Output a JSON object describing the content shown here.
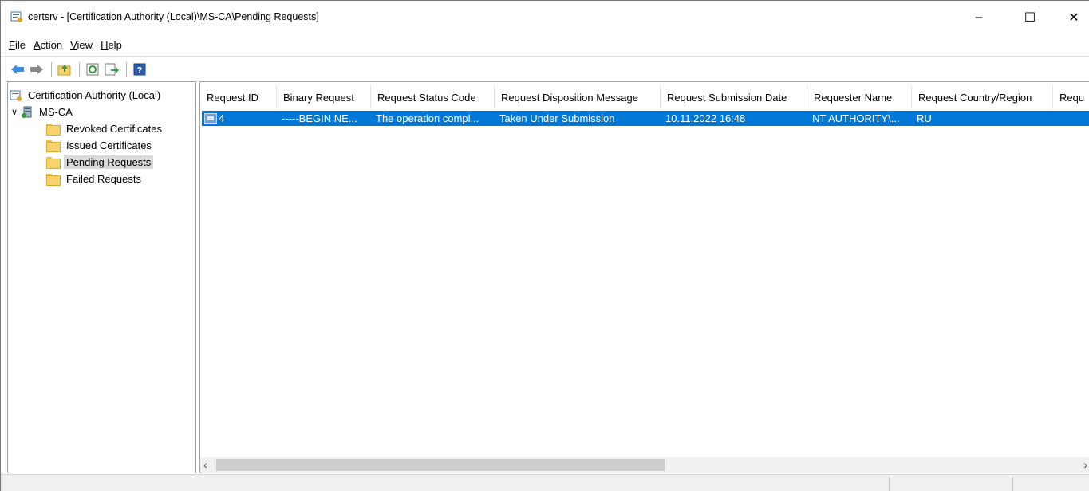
{
  "window": {
    "title": "certsrv - [Certification Authority (Local)\\MS-CA\\Pending Requests]",
    "controls": {
      "minimize": "–",
      "maximize": "☐",
      "close": "✕"
    }
  },
  "menu": {
    "items": [
      {
        "accel": "F",
        "rest": "ile"
      },
      {
        "accel": "A",
        "rest": "ction"
      },
      {
        "accel": "V",
        "rest": "iew"
      },
      {
        "accel": "H",
        "rest": "elp"
      }
    ]
  },
  "toolbar": {
    "buttons": [
      "back-arrow-icon",
      "forward-arrow-icon",
      "up-folder-icon",
      "refresh-icon",
      "export-list-icon",
      "help-icon"
    ]
  },
  "tree": {
    "root": "Certification Authority (Local)",
    "ca": "MS-CA",
    "folders": [
      "Revoked Certificates",
      "Issued Certificates",
      "Pending Requests",
      "Failed Requests"
    ],
    "selected": "Pending Requests"
  },
  "list": {
    "columns": [
      "Request ID",
      "Binary Request",
      "Request Status Code",
      "Request Disposition Message",
      "Request Submission Date",
      "Requester Name",
      "Request Country/Region",
      "Requ"
    ],
    "rows": [
      {
        "id": "4",
        "binary": "-----BEGIN NE...",
        "status": "The operation compl...",
        "disposition": "Taken Under Submission",
        "date": "10.11.2022 16:48",
        "requester": "NT AUTHORITY\\...",
        "country": "RU"
      }
    ]
  },
  "colors": {
    "selection": "#0078d7",
    "tree_selection": "#d9d9d9",
    "statusbar": "#f0f0f0"
  }
}
